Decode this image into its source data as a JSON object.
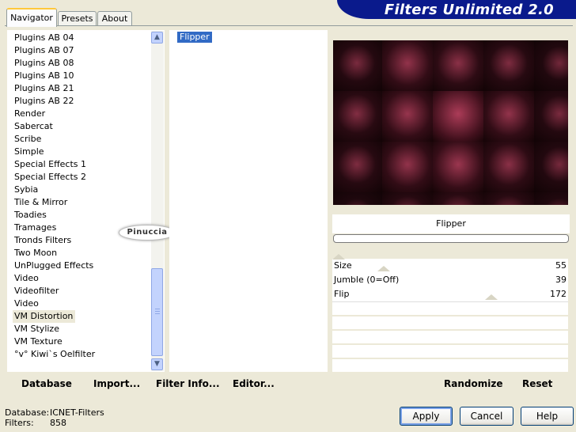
{
  "tabs": [
    {
      "label": "Navigator",
      "active": true
    },
    {
      "label": "Presets",
      "active": false
    },
    {
      "label": "About",
      "active": false
    }
  ],
  "banner": {
    "title": "Filters Unlimited 2.0"
  },
  "categories": {
    "items": [
      "Plugins AB 04",
      "Plugins AB 07",
      "Plugins AB 08",
      "Plugins AB 10",
      "Plugins AB 21",
      "Plugins AB 22",
      "Render",
      "Sabercat",
      "Scribe",
      "Simple",
      "Special Effects 1",
      "Special Effects 2",
      "Sybia",
      "Tile & Mirror",
      "Toadies",
      "Tramages",
      "Tronds Filters",
      "Two Moon",
      "UnPlugged Effects",
      "Video",
      "Videofilter",
      "Video",
      "VM Distortion",
      "VM Stylize",
      "VM Texture",
      "°v° Kiwi`s Oelfilter"
    ],
    "selected": "VM Distortion"
  },
  "filters": {
    "items": [
      "Flipper"
    ],
    "selected": "Flipper"
  },
  "watermark": {
    "text": "Pinuccia"
  },
  "preview": {
    "filter_name": "Flipper"
  },
  "sliders": [
    {
      "label": "Size",
      "value": "55",
      "level": 55
    },
    {
      "label": "Jumble (0=Off)",
      "value": "39",
      "level": 39
    },
    {
      "label": "Flip",
      "value": "172",
      "level": 172
    }
  ],
  "toolbar": {
    "database_label": "Database",
    "import_label": "Import...",
    "filterinfo_label": "Filter Info...",
    "editor_label": "Editor...",
    "randomize_label": "Randomize",
    "reset_label": "Reset"
  },
  "status": {
    "database_key": "Database:",
    "database_value": "ICNET-Filters",
    "filters_key": "Filters:",
    "filters_value": "858"
  },
  "buttons": {
    "apply": "Apply",
    "cancel": "Cancel",
    "help": "Help"
  },
  "colors": {
    "banner": "#0a1a8c",
    "selection": "#316ac5",
    "preview_accent": "#b8405e"
  }
}
